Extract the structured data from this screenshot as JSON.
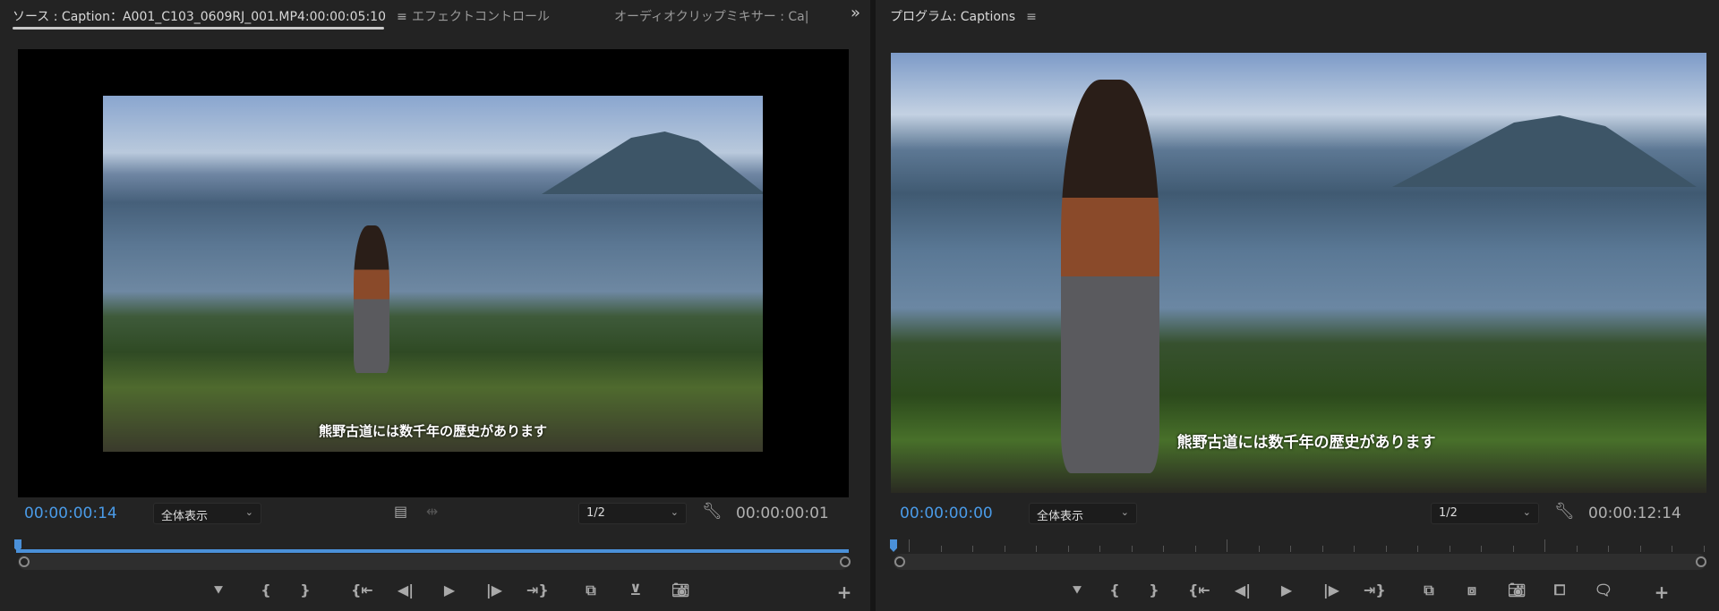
{
  "source": {
    "tabs": [
      {
        "label": "ソース : Caption：A001_C103_0609RJ_001.MP4:00:00:05:10",
        "active": true
      },
      {
        "label": "エフェクトコントロール",
        "active": false
      },
      {
        "label": "オーディオクリップミキサー : Ca|",
        "active": false
      }
    ],
    "menu_icon": "≡",
    "overflow_icon": "»",
    "caption": "熊野古道には数千年の歴史があります",
    "current_timecode": "00:00:00:14",
    "zoom_select": "全体表示",
    "resolution_select": "1/2",
    "duration_timecode": "00:00:00:01",
    "progress": 1.0
  },
  "program": {
    "title": "プログラム: Captions",
    "menu_icon": "≡",
    "caption": "熊野古道には数千年の歴史があります",
    "current_timecode": "00:00:00:00",
    "zoom_select": "全体表示",
    "resolution_select": "1/2",
    "duration_timecode": "00:00:12:14",
    "progress": 0.0
  },
  "colors": {
    "accent": "#4a90d9",
    "timecode": "#4a9be8",
    "bg": "#232323"
  }
}
